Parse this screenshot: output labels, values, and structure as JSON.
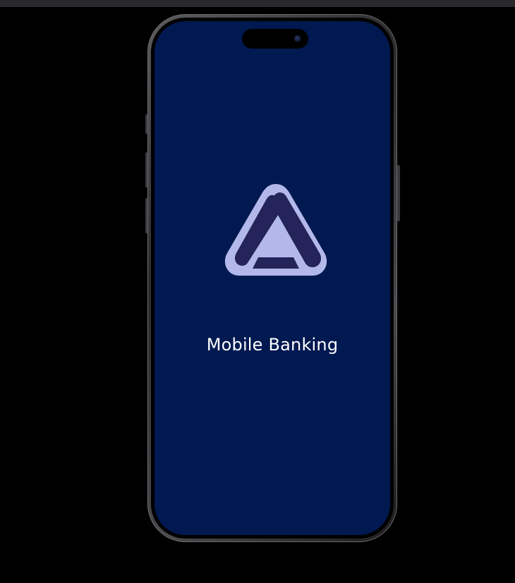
{
  "splash": {
    "title": "Mobile Banking",
    "logo_icon": "banking-a-logo"
  },
  "colors": {
    "screen_background": "#011951",
    "logo_fill": "#b3b8ea",
    "logo_inner": "#25245a",
    "title_text": "#ffffff"
  }
}
